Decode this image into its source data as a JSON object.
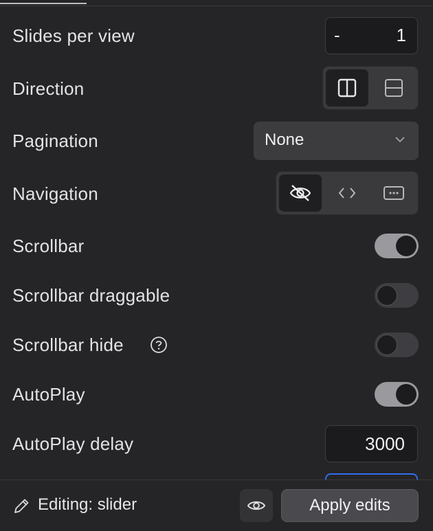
{
  "settings": {
    "slides_per_view": {
      "label": "Slides per view",
      "minus": "-",
      "value": "1"
    },
    "direction": {
      "label": "Direction",
      "options": [
        "columns-icon",
        "rows-icon"
      ],
      "selected": 0
    },
    "pagination": {
      "label": "Pagination",
      "value": "None"
    },
    "navigation": {
      "label": "Navigation",
      "options": [
        "eye-off-icon",
        "code-arrows-icon",
        "dots-box-icon"
      ],
      "selected": 0
    },
    "scrollbar": {
      "label": "Scrollbar",
      "on": true
    },
    "scrollbar_draggable": {
      "label": "Scrollbar draggable",
      "on": false
    },
    "scrollbar_hide": {
      "label": "Scrollbar hide",
      "on": false,
      "help_icon": "help-circle-icon"
    },
    "autoplay": {
      "label": "AutoPlay",
      "on": true
    },
    "autoplay_delay": {
      "label": "AutoPlay delay",
      "value": "3000"
    }
  },
  "footer": {
    "editing_label": "Editing: slider",
    "apply_label": "Apply edits",
    "icons": [
      "pencil-icon",
      "eye-icon"
    ]
  },
  "colors": {
    "background": "#252527",
    "toggle_on": "#9a9a9e",
    "focus_blue": "#2e6ef0"
  }
}
